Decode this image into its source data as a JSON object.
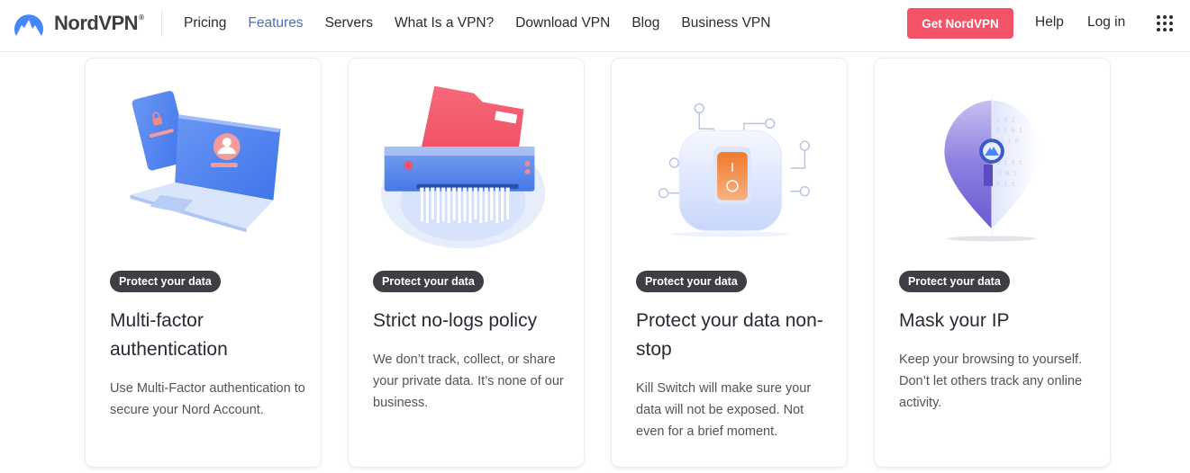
{
  "header": {
    "logo_text": "NordVPN",
    "logo_mark": "®",
    "nav": [
      {
        "label": "Pricing",
        "active": false
      },
      {
        "label": "Features",
        "active": true
      },
      {
        "label": "Servers",
        "active": false
      },
      {
        "label": "What Is a VPN?",
        "active": false
      },
      {
        "label": "Download VPN",
        "active": false
      },
      {
        "label": "Blog",
        "active": false
      },
      {
        "label": "Business VPN",
        "active": false
      }
    ],
    "cta_label": "Get NordVPN",
    "help_label": "Help",
    "login_label": "Log in",
    "apps_icon": "grid-icon"
  },
  "colors": {
    "brand_blue": "#4687ff",
    "active_nav": "#4d6fb8",
    "cta": "#f25366",
    "badge_bg": "#3e3f45"
  },
  "cards": [
    {
      "illustration": "laptop-phone-mfa-illustration",
      "badge": "Protect your data",
      "title": "Multi-factor authentication",
      "description": "Use Multi-Factor authentication to secure your Nord Account."
    },
    {
      "illustration": "folder-shredder-illustration",
      "badge": "Protect your data",
      "title": "Strict no-logs policy",
      "description": "We don’t track, collect, or share your private data. It’s none of our business."
    },
    {
      "illustration": "kill-switch-illustration",
      "badge": "Protect your data",
      "title": "Protect your data non-stop",
      "description": "Kill Switch will make sure your data will not be exposed. Not even for a brief moment."
    },
    {
      "illustration": "location-pin-keyhole-illustration",
      "badge": "Protect your data",
      "title": "Mask your IP",
      "description": "Keep your browsing to yourself. Don’t let others track any online activity."
    }
  ]
}
